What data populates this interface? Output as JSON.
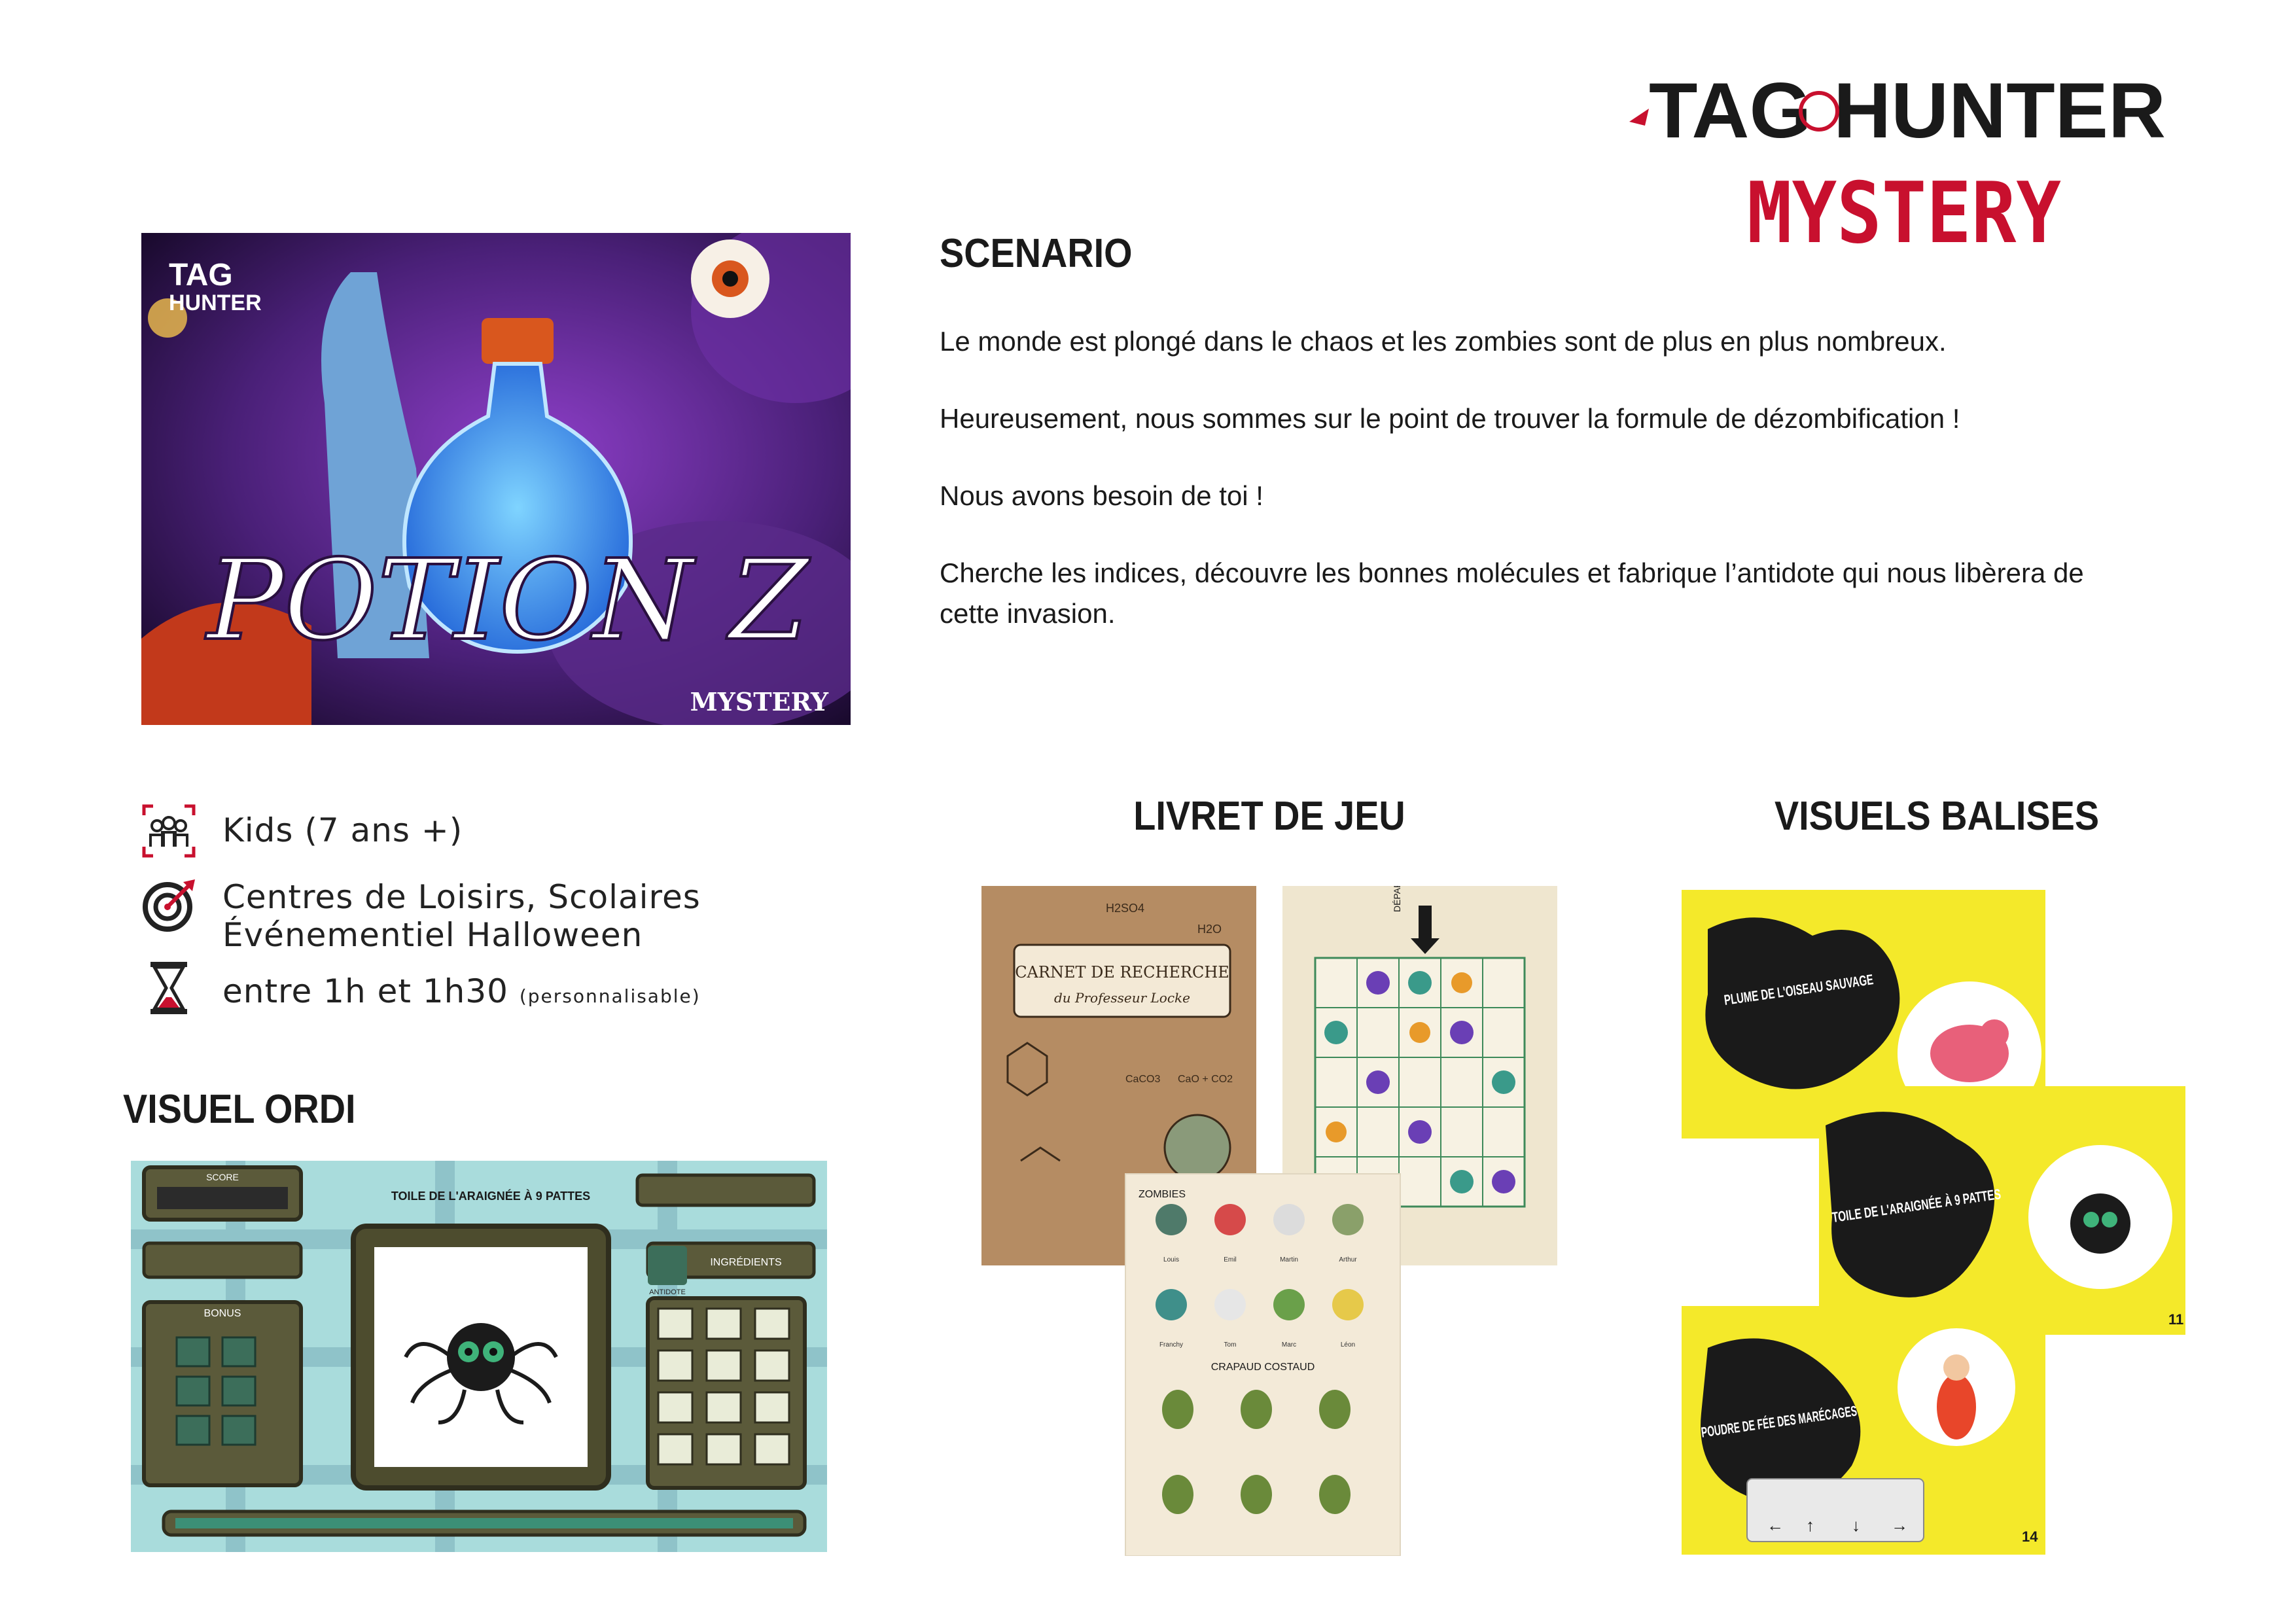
{
  "logo": {
    "line1": "TAG HUNTER",
    "line2": "MYSTERY"
  },
  "cover": {
    "brand_line1": "TAG",
    "brand_line2": "HUNTER",
    "title": "POTION Z",
    "badge": "MYSTERY"
  },
  "scenario": {
    "heading": "SCENARIO",
    "paragraphs": [
      "Le monde est plongé dans le chaos et les zombies sont de plus en plus nombreux.",
      "Heureusement, nous sommes sur le point de trouver la formule de dézombification !",
      "Nous avons besoin de toi !",
      "Cherche les indices, découvre les bonnes molécules et fabrique l’antidote qui nous libèrera de cette invasion."
    ]
  },
  "meta": {
    "audience": {
      "icon": "group-icon",
      "text": "Kids (7 ans +)"
    },
    "venues": {
      "icon": "target-icon",
      "line1": "Centres de Loisirs, Scolaires",
      "line2": "Événementiel Halloween"
    },
    "duration": {
      "icon": "hourglass-icon",
      "text": "entre 1h et 1h30",
      "note": "(personnalisable)"
    }
  },
  "visuel_ordi": {
    "heading": "VISUEL ORDI",
    "score_label": "SCORE",
    "bonus_label": "BONUS",
    "antidote_label": "ANTIDOTE",
    "ingredients_label": "INGRÉDIENTS",
    "center_title": "TOILE DE L'ARAIGNÉE À 9 PATTES"
  },
  "livret": {
    "heading": "LIVRET DE JEU",
    "notebook_title": "CARNET DE RECHERCHE",
    "notebook_sub": "du Professeur Locke",
    "grid_label": "DÉPART",
    "zombies_label": "ZOMBIES",
    "zombie_names": [
      "Louis",
      "Emil",
      "Martin",
      "Arthur",
      "Franchy",
      "Tom",
      "Marc",
      "Léon"
    ],
    "toad_label": "CRAPAUD COSTAUD",
    "formulas": [
      "H2SO4",
      "H2O",
      "CaCO3",
      "CaO + CO2"
    ]
  },
  "balises": {
    "heading": "VISUELS BALISES",
    "card1": "PLUME DE L'OISEAU SAUVAGE",
    "card2": "TOILE DE L'ARAIGNÉE À 9 PATTES",
    "card2_page": "11",
    "card3": "POUDRE DE FÉE DES MARÉCAGES",
    "card3_page": "14"
  },
  "colors": {
    "brand_red": "#c8102e",
    "yellow": "#f4e92a",
    "dark": "#2a2a2a"
  }
}
